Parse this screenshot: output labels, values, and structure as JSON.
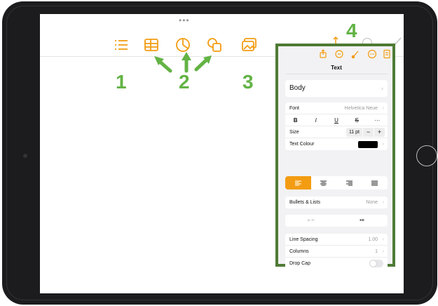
{
  "screen": {
    "more_dots": "•••",
    "toolbar_icons": [
      "list-icon",
      "table-icon",
      "chart-icon",
      "shape-icon",
      "media-icon",
      "share-icon",
      "more-icon",
      "format-brush-icon"
    ]
  },
  "annotations": {
    "label_1": "1",
    "label_2": "2",
    "label_3": "3",
    "label_4": "4",
    "color": "#63b345"
  },
  "panel": {
    "border_color": "#4f7b35",
    "tabs": [
      "share-icon",
      "undo-icon",
      "format-brush-icon",
      "more-icon",
      "document-icon"
    ],
    "header": "Text",
    "paragraph_style": "Body",
    "font": {
      "label": "Font",
      "value": "Helvetica Neue"
    },
    "format_buttons": [
      "B",
      "I",
      "U",
      "S",
      "···"
    ],
    "size": {
      "label": "Size",
      "value": "11 pt",
      "decrease": "−",
      "increase": "+"
    },
    "text_colour": {
      "label": "Text Colour",
      "swatch": "#000000"
    },
    "alignment": {
      "active": "left",
      "options": [
        "left",
        "center",
        "right",
        "justify"
      ],
      "accent": "#f39c12"
    },
    "bullets": {
      "label": "Bullets & Lists",
      "value": "None"
    },
    "indent": {
      "decrease": "⇤≡",
      "increase": "•≡"
    },
    "line_spacing": {
      "label": "Line Spacing",
      "value": "1.00"
    },
    "columns": {
      "label": "Columns",
      "value": "1"
    },
    "drop_cap": {
      "label": "Drop Cap",
      "on": false
    }
  },
  "chevron": "›"
}
